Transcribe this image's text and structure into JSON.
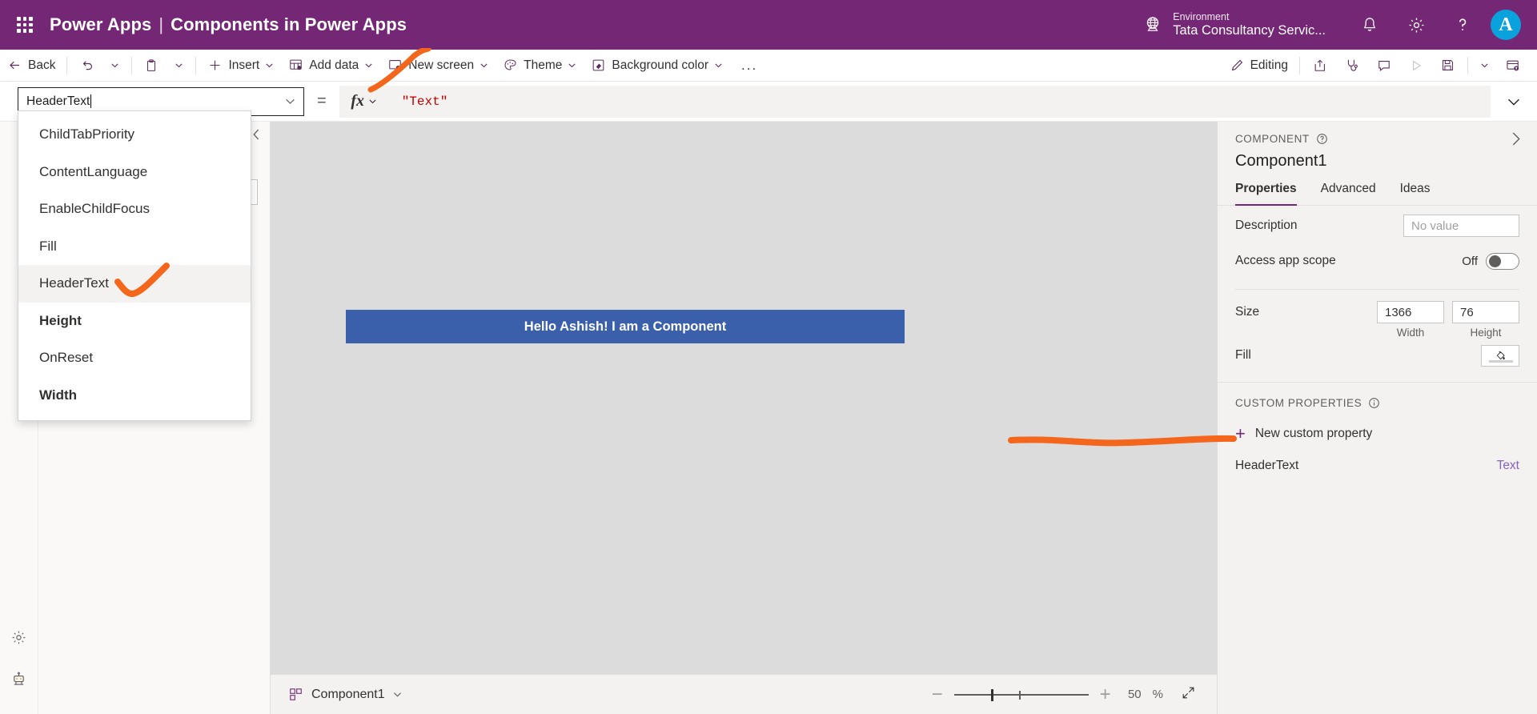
{
  "header": {
    "waffle_icon": "waffle-grid-icon",
    "brand": "Power Apps",
    "separator": "|",
    "app_title": "Components in Power Apps",
    "environment_label": "Environment",
    "environment_name": "Tata Consultancy Servic...",
    "globe_icon": "globe-icon",
    "notification_icon": "bell-icon",
    "settings_icon": "gear-icon",
    "help_icon": "question-mark-icon",
    "avatar_initial": "A",
    "avatar_color": "#09a2dd",
    "brand_color": "#742774"
  },
  "commandbar": {
    "back": "Back",
    "undo_icon": "undo-icon",
    "paste_icon": "clipboard-icon",
    "insert": "Insert",
    "add_data": "Add data",
    "new_screen": "New screen",
    "theme": "Theme",
    "background_color": "Background color",
    "overflow": "...",
    "editing": "Editing",
    "share_icon": "share-icon",
    "app_checker_icon": "stethoscope-icon",
    "comment_icon": "comment-icon",
    "preview_icon": "play-icon",
    "save_icon": "save-icon",
    "publish_icon": "publish-icon"
  },
  "formulabar": {
    "property_value": "HeaderText",
    "equals": "=",
    "fx_label": "fx",
    "formula": "\"Text\"",
    "expand_icon": "chevron-down-icon"
  },
  "property_dropdown": {
    "items": [
      {
        "label": "ChildTabPriority",
        "bold": false,
        "hovered": false
      },
      {
        "label": "ContentLanguage",
        "bold": false,
        "hovered": false
      },
      {
        "label": "EnableChildFocus",
        "bold": false,
        "hovered": false
      },
      {
        "label": "Fill",
        "bold": false,
        "hovered": false
      },
      {
        "label": "HeaderText",
        "bold": false,
        "hovered": true
      },
      {
        "label": "Height",
        "bold": true,
        "hovered": false
      },
      {
        "label": "OnReset",
        "bold": false,
        "hovered": false
      },
      {
        "label": "Width",
        "bold": true,
        "hovered": false
      }
    ]
  },
  "leftrail": {
    "settings_icon": "gear-icon",
    "bot_icon": "robot-icon"
  },
  "treepanel": {
    "collapse_icon": "chevron-left-icon"
  },
  "canvas": {
    "component_text": "Hello Ashish! I am a Component",
    "component_fill": "#3a5fab",
    "background": "#dcdcdc"
  },
  "statusbar": {
    "component_icon": "component-icon",
    "component_name": "Component1",
    "component_chevron": "chevron-down-icon",
    "zoom_out": "−",
    "zoom_in": "+",
    "zoom_value": "50",
    "zoom_unit": "%",
    "fit_icon": "expand-diagonal-icon"
  },
  "rightpanel": {
    "kicker": "COMPONENT",
    "kicker_help_icon": "question-circle-icon",
    "expand_icon": "chevron-right-icon",
    "title": "Component1",
    "tabs": [
      {
        "label": "Properties",
        "active": true
      },
      {
        "label": "Advanced",
        "active": false
      },
      {
        "label": "Ideas",
        "active": false
      }
    ],
    "description_label": "Description",
    "description_placeholder": "No value",
    "access_app_scope_label": "Access app scope",
    "access_app_scope_state": "Off",
    "size_label": "Size",
    "size_width": "1366",
    "size_height": "76",
    "width_caption": "Width",
    "height_caption": "Height",
    "fill_label": "Fill",
    "fill_icon": "paint-bucket-icon",
    "custom_properties_kicker": "CUSTOM PROPERTIES",
    "custom_properties_info_icon": "info-circle-icon",
    "new_custom_property": "New custom property",
    "custom_property_name": "HeaderText",
    "custom_property_type": "Text",
    "custom_property_type_color": "#8764b8"
  },
  "annotations": {
    "color": "#f4661b",
    "marks": [
      "checkmark-over-formula-bar",
      "checkmark-on-headertext-dropdown-item",
      "underline-under-headertext-custom-property"
    ]
  }
}
